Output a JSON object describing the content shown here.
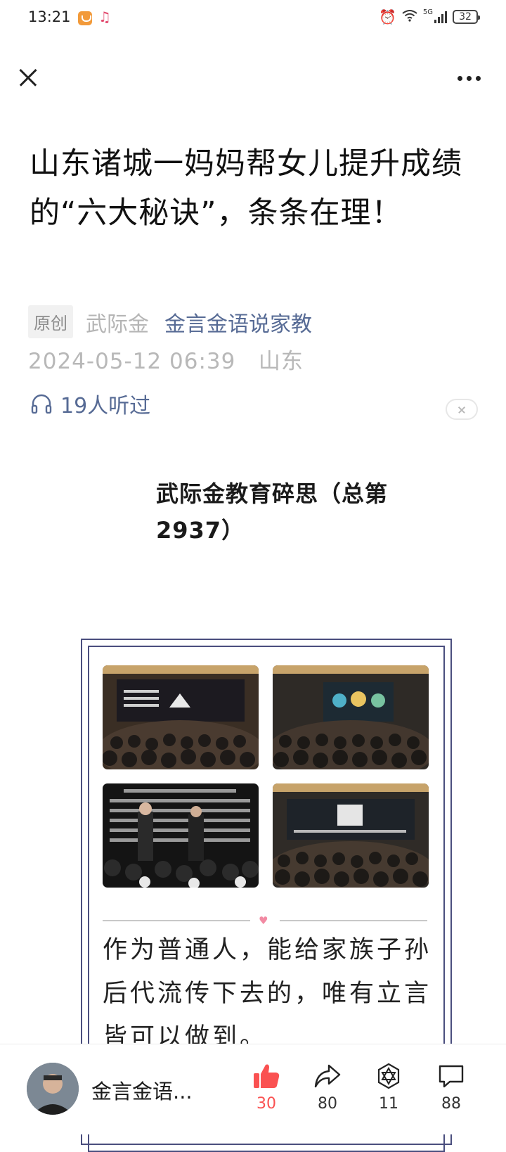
{
  "status_bar": {
    "time": "13:21",
    "network": "5G",
    "battery": "32"
  },
  "article": {
    "title": "山东诸城一妈妈帮女儿提升成绩的“六大秘诀”，条条在理！",
    "original_badge": "原创",
    "author": "武际金",
    "account": "金言金语说家教",
    "date": "2024-05-12 06:39",
    "location": "山东",
    "listen_count": "19人听过",
    "section_heading": "武际金教育碎思（总第2937）",
    "paragraph": "作为普通人，能给家族子孙后代流传下去的，唯有立言皆可以做到。"
  },
  "bottom_bar": {
    "account_name": "金言金语...",
    "like_count": "30",
    "share_count": "80",
    "recommend_count": "11",
    "comment_count": "88"
  },
  "colors": {
    "link": "#576b95",
    "like": "#fa5151",
    "frame": "#4a4e7e"
  }
}
